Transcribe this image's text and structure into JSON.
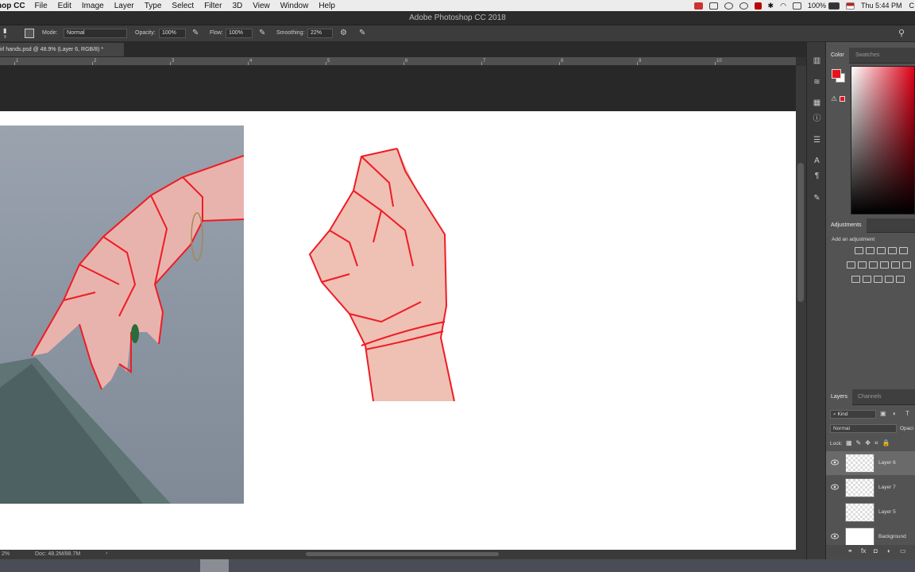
{
  "menubar": {
    "app_name": "hop CC",
    "items": [
      "File",
      "Edit",
      "Image",
      "Layer",
      "Type",
      "Select",
      "Filter",
      "3D",
      "View",
      "Window",
      "Help"
    ],
    "battery": "100%",
    "clock": "Thu 5:44 PM",
    "overflow": "C"
  },
  "title": "Adobe Photoshop CC 2018",
  "options": {
    "brush_size": "9",
    "mode_label": "Mode:",
    "mode_value": "Normal",
    "opacity_label": "Opacity:",
    "opacity_value": "100%",
    "flow_label": "Flow:",
    "flow_value": "100%",
    "smoothing_label": "Smoothing:",
    "smoothing_value": "22%"
  },
  "document_tab": "irl hands.psd @ 48.9% (Layer 6, RGB/8) *",
  "ruler_ticks": [
    "1",
    "2",
    "3",
    "4",
    "5",
    "6",
    "7",
    "8",
    "9",
    "10"
  ],
  "status": {
    "zoom": "2%",
    "doc": "Doc: 48.2M/88.7M"
  },
  "color_panel": {
    "tabs": [
      "Color",
      "Swatches"
    ],
    "fg": "#e8121d",
    "bg": "#ffffff"
  },
  "adjustments": {
    "title": "Adjustments",
    "subtitle": "Add an adjustment"
  },
  "layers_panel": {
    "tabs": [
      "Layers",
      "Channels"
    ],
    "filter_label": "Kind",
    "blend_mode": "Normal",
    "opacity_label": "Opaci",
    "lock_label": "Lock:",
    "layers": [
      {
        "name": "Layer 6",
        "visible": true,
        "selected": true
      },
      {
        "name": "Layer 7",
        "visible": true,
        "selected": false
      },
      {
        "name": "Layer 5",
        "visible": false,
        "selected": false
      },
      {
        "name": "Background",
        "visible": true,
        "selected": false
      }
    ],
    "footer_fx": "fx"
  }
}
